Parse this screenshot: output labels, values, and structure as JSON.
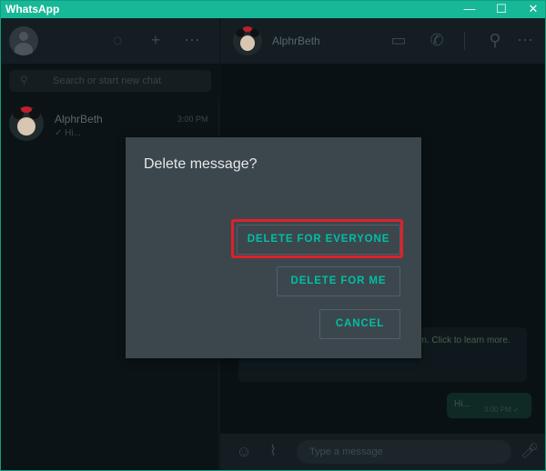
{
  "window": {
    "title": "WhatsApp",
    "controls": {
      "minimize": "—",
      "maximize": "☐",
      "close": "✕"
    }
  },
  "left_pane": {
    "header_icons": {
      "status": "status-icon",
      "new_chat": "plus-icon",
      "menu": "more-icon"
    },
    "search": {
      "placeholder": "Search or start new chat"
    },
    "chats": [
      {
        "name": "AlphrBeth",
        "time": "3:00 PM",
        "preview": "✓ Hi..."
      }
    ]
  },
  "right_pane": {
    "contact_name": "AlphrBeth",
    "encryption_notice": "…pted. No one outside of … listen to them. Click to learn more.",
    "messages": [
      {
        "text": "Hi...",
        "time": "3:00 PM ✓"
      }
    ],
    "composer": {
      "placeholder": "Type a message"
    }
  },
  "dialog": {
    "title": "Delete message?",
    "buttons": {
      "delete_everyone": "DELETE FOR EVERYONE",
      "delete_me": "DELETE FOR ME",
      "cancel": "CANCEL"
    },
    "accent_color": "#00bfa5",
    "highlight_color": "#e0202a"
  }
}
